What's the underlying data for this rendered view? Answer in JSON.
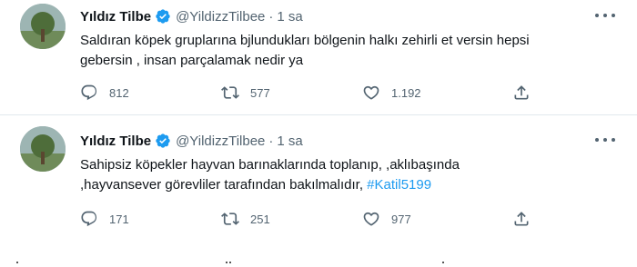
{
  "tweets": [
    {
      "name": "Yıldız Tilbe",
      "handle": "@YildizzTilbee",
      "time": "1 sa",
      "text_lines": [
        "Saldıran köpek gruplarına bjlundukları bölgenin halkı zehirli et versin hepsi",
        "gebersin , insan parçalamak nedir ya"
      ],
      "hashtag": "",
      "replies": "812",
      "retweets": "577",
      "likes": "1.192"
    },
    {
      "name": "Yıldız Tilbe",
      "handle": "@YildizzTilbee",
      "time": "1 sa",
      "text_lines": [
        "Sahipsiz köpekler hayvan barınaklarında toplanıp,    ,aklıbaşında",
        ",hayvansever görevliler tarafından bakılmalıdır,"
      ],
      "hashtag": "#Katil5199",
      "replies": "171",
      "retweets": "251",
      "likes": "977"
    }
  ],
  "icons": {
    "verified": "verified-badge-icon",
    "reply": "reply-icon",
    "retweet": "retweet-icon",
    "like": "like-icon",
    "share": "share-icon",
    "more": "more-icon"
  },
  "colors": {
    "verified": "#1d9bf0",
    "hashtag": "#1d9bf0",
    "muted": "#536471"
  }
}
